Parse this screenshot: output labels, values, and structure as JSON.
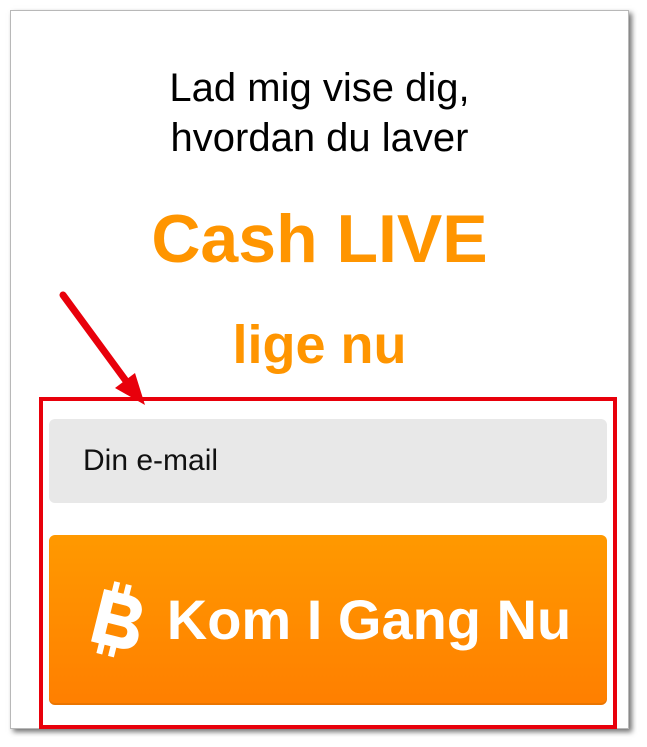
{
  "headline": {
    "line1": "Lad mig vise dig,",
    "line2": "hvordan du laver"
  },
  "brand": {
    "title": "Cash LIVE",
    "subtitle": "lige nu"
  },
  "form": {
    "email_placeholder": "Din e-mail",
    "submit_label": "Kom I Gang Nu",
    "submit_icon": "bitcoin-icon"
  },
  "colors": {
    "accent_orange": "#ff9500",
    "highlight_red": "#e8000b",
    "input_bg": "#e8e8e8"
  }
}
